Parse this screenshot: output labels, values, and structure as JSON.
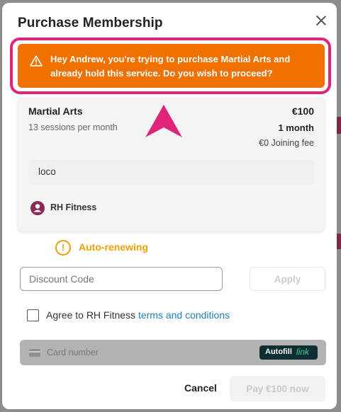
{
  "modal": {
    "title": "Purchase Membership"
  },
  "alert": {
    "message": "Hey Andrew, you're trying to purchase Martial Arts and already hold this service. Do you wish to proceed?",
    "highlight_color": "#e0247a",
    "background_color": "#f07100"
  },
  "plan": {
    "name": "Martial Arts",
    "sessions": "13 sessions per month",
    "price": "€100",
    "period": "1 month",
    "joining_fee": "€0 Joining fee",
    "description": "loco",
    "gym_name": "RH Fitness"
  },
  "renewal": {
    "label": "Auto-renewing",
    "icon": "!"
  },
  "discount": {
    "placeholder": "Discount Code",
    "apply_label": "Apply"
  },
  "terms": {
    "prefix": "Agree to RH Fitness ",
    "link_text": "terms and conditions"
  },
  "payment": {
    "card_placeholder": "Card number",
    "autofill_label": "Autofill",
    "link_label": "link"
  },
  "actions": {
    "cancel_label": "Cancel",
    "pay_label": "Pay €100 now"
  }
}
